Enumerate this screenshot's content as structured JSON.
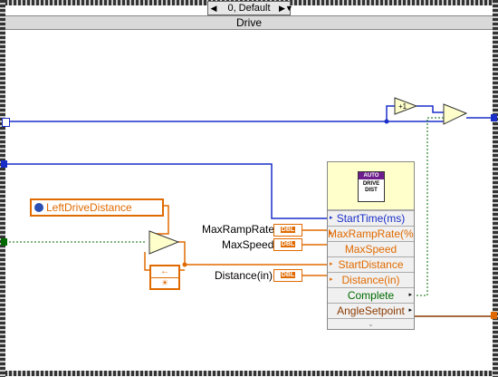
{
  "selector": {
    "value": "0, Default",
    "left_arrow": "◀",
    "right_arrow": "▶",
    "dropdown": "▼"
  },
  "case_label": "Drive",
  "node": {
    "icon_top": "AUTO",
    "icon_text_1": "DRIVE",
    "icon_text_2": "DIST",
    "terminals": [
      {
        "label": "StartTime(ms)",
        "color": "blue"
      },
      {
        "label": "MaxRampRate(%/s)",
        "color": "orange"
      },
      {
        "label": "MaxSpeed",
        "color": "orange"
      },
      {
        "label": "StartDistance",
        "color": "orange"
      },
      {
        "label": "Distance(in)",
        "color": "orange"
      },
      {
        "label": "Complete",
        "color": "green"
      },
      {
        "label": "AngleSetpoint",
        "color": "brown"
      }
    ]
  },
  "constants": [
    {
      "label": "MaxRampRate(%/s)",
      "type": "DBL"
    },
    {
      "label": "MaxSpeed",
      "type": "DBL"
    },
    {
      "label": "Distance(in)",
      "type": "DBL"
    }
  ],
  "control": {
    "label": "LeftDriveDistance"
  },
  "increment": "+1",
  "feedback_arrow": "←",
  "feedback_init": "☀",
  "colors": {
    "orange": "#e06a00",
    "blue": "#1a2ec8",
    "green": "#006a00",
    "brown": "#8a3a00"
  }
}
